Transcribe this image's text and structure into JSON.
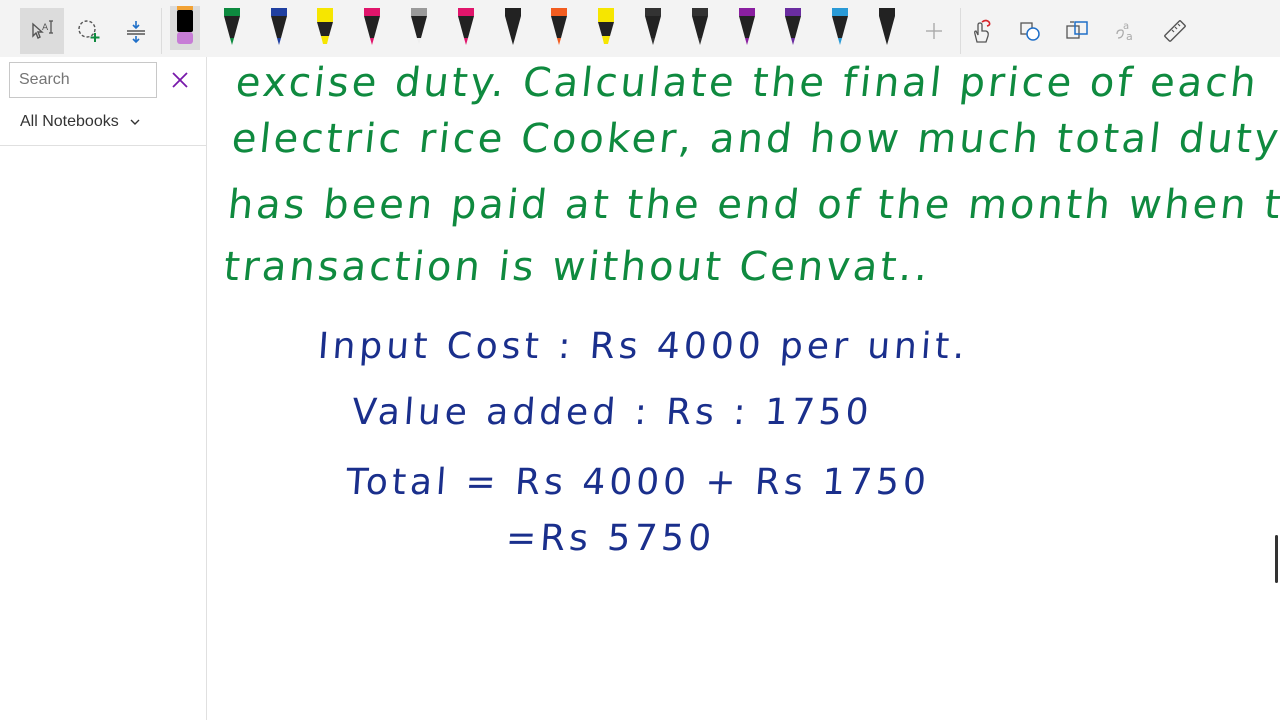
{
  "toolbar": {
    "left_tools": [
      {
        "name": "lasso-select-tool",
        "icon": "lasso-select-icon"
      },
      {
        "name": "add-shape-select-tool",
        "icon": "circle-plus-icon"
      },
      {
        "name": "add-space-tool",
        "icon": "insert-space-icon"
      }
    ],
    "pens": [
      {
        "color": "#000000",
        "cap": "#c77dd6",
        "type": "marker",
        "selected": true
      },
      {
        "color": "#0d8a3f",
        "type": "pen"
      },
      {
        "color": "#1f3fa0",
        "type": "pen"
      },
      {
        "color": "#f6e600",
        "type": "highlighter"
      },
      {
        "color": "#e0156b",
        "type": "pen"
      },
      {
        "color": "#9a9a9a",
        "type": "pencil"
      },
      {
        "color": "#e0156b",
        "type": "pen"
      },
      {
        "color": "#222222",
        "type": "pen"
      },
      {
        "color": "#f25c1f",
        "type": "pen"
      },
      {
        "color": "#f6e600",
        "type": "highlighter"
      },
      {
        "color": "#333333",
        "type": "pen"
      },
      {
        "color": "#333333",
        "type": "pen"
      },
      {
        "color": "#8a1fa0",
        "type": "pen"
      },
      {
        "color": "#6a2da0",
        "type": "pen"
      },
      {
        "color": "#2a9ad6",
        "type": "pen"
      },
      {
        "color": "#222222",
        "type": "pen"
      }
    ],
    "right_tools": [
      {
        "name": "add-pen-button",
        "icon": "plus-icon"
      },
      {
        "name": "touch-draw-button",
        "icon": "hand-draw-icon"
      },
      {
        "name": "ink-to-shape-button",
        "icon": "ink-to-shape-icon"
      },
      {
        "name": "ink-to-text-button",
        "icon": "ink-to-text-icon"
      },
      {
        "name": "ink-to-math-button",
        "icon": "ink-to-math-icon"
      },
      {
        "name": "ruler-button",
        "icon": "ruler-icon"
      }
    ]
  },
  "sidebar": {
    "search": {
      "placeholder": "Search",
      "value": ""
    },
    "notebooks_label": "All Notebooks"
  },
  "canvas": {
    "question_lines": [
      "excise duty. Calculate the final price of each",
      "electric rice Cooker, and how much total duty",
      "has been paid at the end of the month when the",
      "transaction is without Cenvat.."
    ],
    "solution_lines": [
      "Input Cost : Rs 4000 per unit.",
      "Value added : Rs : 1750",
      "Total = Rs  4000 + Rs 1750",
      "=Rs 5750"
    ]
  },
  "colors": {
    "accent": "#7719AA",
    "green_ink": "#0f8a3f",
    "blue_ink": "#1a2f8c"
  }
}
